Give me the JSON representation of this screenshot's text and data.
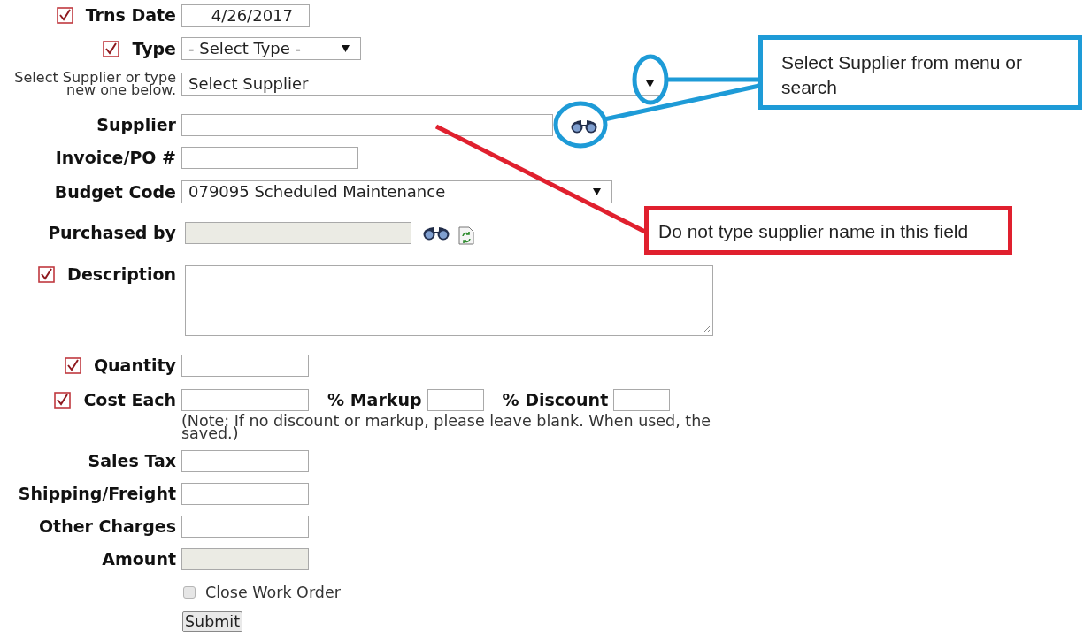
{
  "form": {
    "fields": [
      {
        "kind": "text",
        "label": "Trns Date",
        "required": true,
        "disabled": false,
        "value": "4/26/2017"
      },
      {
        "kind": "select",
        "label": "Type",
        "required": true,
        "value": "- Select Type -"
      },
      {
        "kind": "lookup",
        "label": "Select Supplier or type new one below.",
        "required": false,
        "value": "Select Supplier"
      },
      {
        "kind": "text",
        "label": "Supplier",
        "required": false,
        "disabled": false,
        "search": true
      },
      {
        "kind": "text",
        "label": "Invoice/PO #",
        "required": false,
        "disabled": false
      },
      {
        "kind": "select",
        "label": "Budget Code",
        "required": false,
        "value": "079095 Scheduled Maintenance"
      },
      {
        "kind": "text",
        "label": "Purchased by",
        "required": false,
        "disabled": true,
        "search": true,
        "refresh": true
      },
      {
        "kind": "textarea",
        "label": "Description",
        "required": true
      },
      {
        "kind": "text",
        "label": "Quantity",
        "required": true,
        "disabled": false
      },
      {
        "kind": "cost",
        "label": "Cost Each",
        "required": true,
        "extras": [
          {
            "label": "% Markup"
          },
          {
            "label": "% Discount"
          }
        ]
      },
      {
        "kind": "note",
        "text": "(Note: If no discount or markup, please leave blank. When used, the saved.)"
      },
      {
        "kind": "text",
        "label": "Sales Tax",
        "required": false,
        "disabled": false
      },
      {
        "kind": "text",
        "label": "Shipping/Freight",
        "required": false,
        "disabled": false
      },
      {
        "kind": "text",
        "label": "Other Charges",
        "required": false,
        "disabled": false
      },
      {
        "kind": "text",
        "label": "Amount",
        "required": false,
        "disabled": true
      },
      {
        "kind": "checkbox",
        "label": "Close Work Order",
        "checked": false
      },
      {
        "kind": "button",
        "label": "Submit"
      }
    ]
  },
  "annotations": [
    {
      "text": "Select Supplier from menu or search",
      "color": "#1e9bd7"
    },
    {
      "text": "Do not type supplier name in this field",
      "color": "#e0202e"
    }
  ]
}
